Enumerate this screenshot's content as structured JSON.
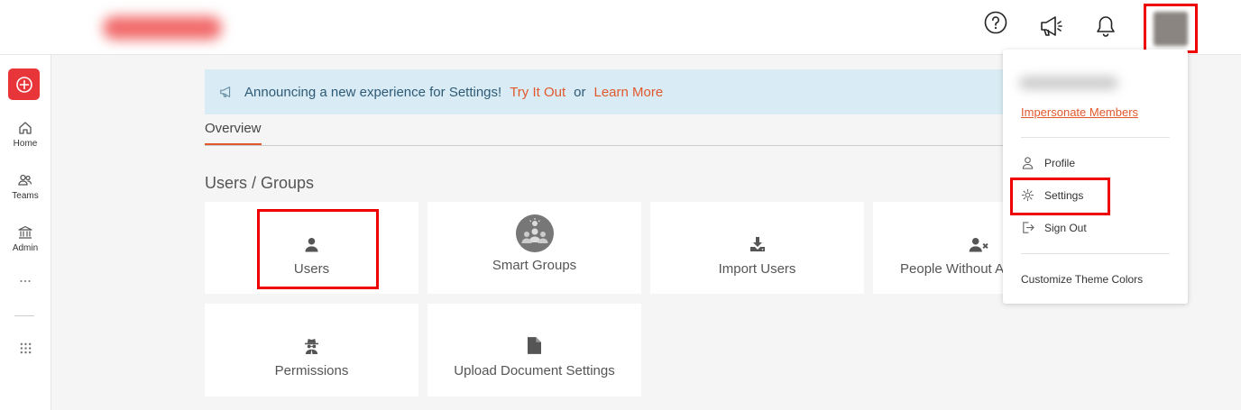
{
  "header": {
    "icons": [
      "help-icon",
      "announcements-icon",
      "notifications-icon",
      "avatar"
    ]
  },
  "leftnav": {
    "items": [
      {
        "label": "Home",
        "icon": "home-icon"
      },
      {
        "label": "Teams",
        "icon": "teams-icon"
      },
      {
        "label": "Admin",
        "icon": "admin-icon"
      }
    ]
  },
  "banner": {
    "text": "Announcing a new experience for Settings!",
    "try_label": "Try It Out",
    "or_label": "or",
    "learn_label": "Learn More"
  },
  "tabs": {
    "overview": "Overview"
  },
  "section": {
    "title": "Users / Groups"
  },
  "cards": [
    {
      "label": "Users",
      "icon": "user-icon"
    },
    {
      "label": "Smart Groups",
      "icon": "smart-groups-icon"
    },
    {
      "label": "Import Users",
      "icon": "import-icon"
    },
    {
      "label": "People Without A",
      "icon": "user-x-icon"
    },
    {
      "label": "Permissions",
      "icon": "spy-icon"
    },
    {
      "label": "Upload Document Settings",
      "icon": "document-icon"
    }
  ],
  "dropdown": {
    "impersonate": "Impersonate Members",
    "profile": "Profile",
    "settings": "Settings",
    "signout": "Sign Out",
    "customize": "Customize Theme Colors"
  },
  "colors": {
    "accent": "#e2582d",
    "highlight": "#ee0000",
    "banner_bg": "#d9ecf5",
    "create_button": "#e8353a"
  }
}
